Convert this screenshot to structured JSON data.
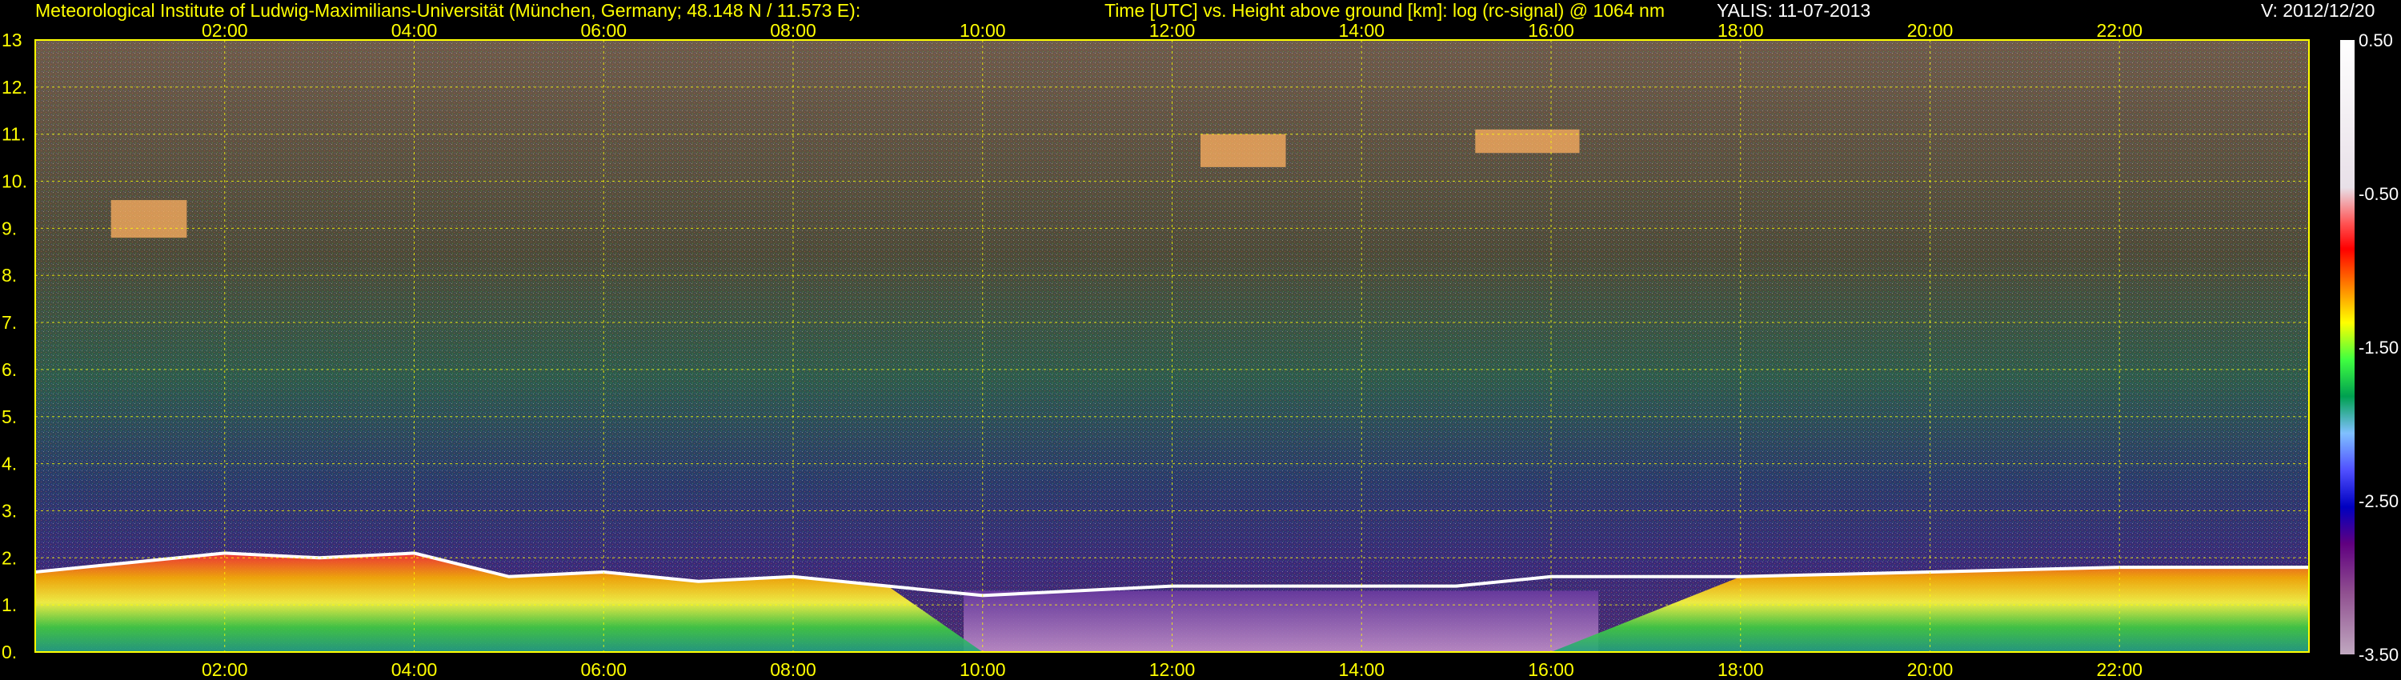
{
  "header": {
    "institute": "Meteorological Institute of Ludwig-Maximilians-Universität (München, Germany; 48.148 N / 11.573 E):",
    "title": "Time [UTC] vs. Height above ground [km]: log (rc-signal) @ 1064 nm",
    "instrument": "YALIS: 11-07-2013",
    "version": "V: 2012/12/20"
  },
  "chart_data": {
    "type": "heatmap",
    "title": "Time [UTC] vs. Height above ground [km]: log (rc-signal) @ 1064 nm",
    "xlabel": "Time [UTC]",
    "ylabel": "Height above ground [km]",
    "x_range_hours": [
      0,
      24
    ],
    "x_ticks": [
      "02:00",
      "04:00",
      "06:00",
      "08:00",
      "10:00",
      "12:00",
      "14:00",
      "16:00",
      "18:00",
      "20:00",
      "22:00"
    ],
    "x_tick_hours": [
      2,
      4,
      6,
      8,
      10,
      12,
      14,
      16,
      18,
      20,
      22
    ],
    "y_range_km": [
      0,
      13
    ],
    "y_ticks": [
      "0.",
      "1.",
      "2.",
      "3.",
      "4.",
      "5.",
      "6.",
      "7.",
      "8.",
      "9.",
      "10.",
      "11.",
      "12.",
      "13"
    ],
    "y_tick_values": [
      0,
      1,
      2,
      3,
      4,
      5,
      6,
      7,
      8,
      9,
      10,
      11,
      12,
      13
    ],
    "grid": true,
    "colorbar": {
      "range": [
        -3.5,
        0.5
      ],
      "ticks": [
        "0.50",
        "-0.50",
        "-1.50",
        "-2.50",
        "-3.50"
      ],
      "tick_values": [
        0.5,
        -0.5,
        -1.5,
        -2.5,
        -3.5
      ]
    },
    "boundary_layer_top_km": [
      {
        "hour": 0.0,
        "km": 1.7
      },
      {
        "hour": 1.0,
        "km": 1.9
      },
      {
        "hour": 2.0,
        "km": 2.1
      },
      {
        "hour": 3.0,
        "km": 2.0
      },
      {
        "hour": 4.0,
        "km": 2.1
      },
      {
        "hour": 5.0,
        "km": 1.6
      },
      {
        "hour": 6.0,
        "km": 1.7
      },
      {
        "hour": 7.0,
        "km": 1.5
      },
      {
        "hour": 8.0,
        "km": 1.6
      },
      {
        "hour": 9.0,
        "km": 1.4
      },
      {
        "hour": 10.0,
        "km": 1.2
      },
      {
        "hour": 11.0,
        "km": 1.3
      },
      {
        "hour": 12.0,
        "km": 1.4
      },
      {
        "hour": 15.0,
        "km": 1.4
      },
      {
        "hour": 16.0,
        "km": 1.6
      },
      {
        "hour": 18.0,
        "km": 1.6
      },
      {
        "hour": 20.0,
        "km": 1.7
      },
      {
        "hour": 22.0,
        "km": 1.8
      },
      {
        "hour": 24.0,
        "km": 1.8
      }
    ],
    "cirrus_layers": [
      {
        "start_hour": 0.8,
        "end_hour": 1.6,
        "base_km": 8.8,
        "top_km": 9.6
      },
      {
        "start_hour": 12.3,
        "end_hour": 13.2,
        "base_km": 10.3,
        "top_km": 11.0
      },
      {
        "start_hour": 15.2,
        "end_hour": 16.3,
        "base_km": 10.6,
        "top_km": 11.1
      }
    ]
  }
}
